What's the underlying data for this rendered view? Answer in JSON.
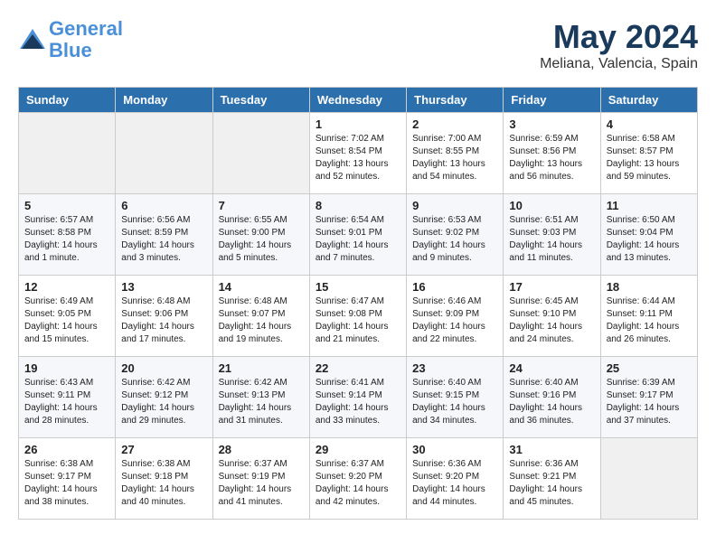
{
  "header": {
    "logo_line1": "General",
    "logo_line2": "Blue",
    "month": "May 2024",
    "location": "Meliana, Valencia, Spain"
  },
  "weekdays": [
    "Sunday",
    "Monday",
    "Tuesday",
    "Wednesday",
    "Thursday",
    "Friday",
    "Saturday"
  ],
  "weeks": [
    [
      {
        "day": "",
        "info": ""
      },
      {
        "day": "",
        "info": ""
      },
      {
        "day": "",
        "info": ""
      },
      {
        "day": "1",
        "info": "Sunrise: 7:02 AM\nSunset: 8:54 PM\nDaylight: 13 hours\nand 52 minutes."
      },
      {
        "day": "2",
        "info": "Sunrise: 7:00 AM\nSunset: 8:55 PM\nDaylight: 13 hours\nand 54 minutes."
      },
      {
        "day": "3",
        "info": "Sunrise: 6:59 AM\nSunset: 8:56 PM\nDaylight: 13 hours\nand 56 minutes."
      },
      {
        "day": "4",
        "info": "Sunrise: 6:58 AM\nSunset: 8:57 PM\nDaylight: 13 hours\nand 59 minutes."
      }
    ],
    [
      {
        "day": "5",
        "info": "Sunrise: 6:57 AM\nSunset: 8:58 PM\nDaylight: 14 hours\nand 1 minute."
      },
      {
        "day": "6",
        "info": "Sunrise: 6:56 AM\nSunset: 8:59 PM\nDaylight: 14 hours\nand 3 minutes."
      },
      {
        "day": "7",
        "info": "Sunrise: 6:55 AM\nSunset: 9:00 PM\nDaylight: 14 hours\nand 5 minutes."
      },
      {
        "day": "8",
        "info": "Sunrise: 6:54 AM\nSunset: 9:01 PM\nDaylight: 14 hours\nand 7 minutes."
      },
      {
        "day": "9",
        "info": "Sunrise: 6:53 AM\nSunset: 9:02 PM\nDaylight: 14 hours\nand 9 minutes."
      },
      {
        "day": "10",
        "info": "Sunrise: 6:51 AM\nSunset: 9:03 PM\nDaylight: 14 hours\nand 11 minutes."
      },
      {
        "day": "11",
        "info": "Sunrise: 6:50 AM\nSunset: 9:04 PM\nDaylight: 14 hours\nand 13 minutes."
      }
    ],
    [
      {
        "day": "12",
        "info": "Sunrise: 6:49 AM\nSunset: 9:05 PM\nDaylight: 14 hours\nand 15 minutes."
      },
      {
        "day": "13",
        "info": "Sunrise: 6:48 AM\nSunset: 9:06 PM\nDaylight: 14 hours\nand 17 minutes."
      },
      {
        "day": "14",
        "info": "Sunrise: 6:48 AM\nSunset: 9:07 PM\nDaylight: 14 hours\nand 19 minutes."
      },
      {
        "day": "15",
        "info": "Sunrise: 6:47 AM\nSunset: 9:08 PM\nDaylight: 14 hours\nand 21 minutes."
      },
      {
        "day": "16",
        "info": "Sunrise: 6:46 AM\nSunset: 9:09 PM\nDaylight: 14 hours\nand 22 minutes."
      },
      {
        "day": "17",
        "info": "Sunrise: 6:45 AM\nSunset: 9:10 PM\nDaylight: 14 hours\nand 24 minutes."
      },
      {
        "day": "18",
        "info": "Sunrise: 6:44 AM\nSunset: 9:11 PM\nDaylight: 14 hours\nand 26 minutes."
      }
    ],
    [
      {
        "day": "19",
        "info": "Sunrise: 6:43 AM\nSunset: 9:11 PM\nDaylight: 14 hours\nand 28 minutes."
      },
      {
        "day": "20",
        "info": "Sunrise: 6:42 AM\nSunset: 9:12 PM\nDaylight: 14 hours\nand 29 minutes."
      },
      {
        "day": "21",
        "info": "Sunrise: 6:42 AM\nSunset: 9:13 PM\nDaylight: 14 hours\nand 31 minutes."
      },
      {
        "day": "22",
        "info": "Sunrise: 6:41 AM\nSunset: 9:14 PM\nDaylight: 14 hours\nand 33 minutes."
      },
      {
        "day": "23",
        "info": "Sunrise: 6:40 AM\nSunset: 9:15 PM\nDaylight: 14 hours\nand 34 minutes."
      },
      {
        "day": "24",
        "info": "Sunrise: 6:40 AM\nSunset: 9:16 PM\nDaylight: 14 hours\nand 36 minutes."
      },
      {
        "day": "25",
        "info": "Sunrise: 6:39 AM\nSunset: 9:17 PM\nDaylight: 14 hours\nand 37 minutes."
      }
    ],
    [
      {
        "day": "26",
        "info": "Sunrise: 6:38 AM\nSunset: 9:17 PM\nDaylight: 14 hours\nand 38 minutes."
      },
      {
        "day": "27",
        "info": "Sunrise: 6:38 AM\nSunset: 9:18 PM\nDaylight: 14 hours\nand 40 minutes."
      },
      {
        "day": "28",
        "info": "Sunrise: 6:37 AM\nSunset: 9:19 PM\nDaylight: 14 hours\nand 41 minutes."
      },
      {
        "day": "29",
        "info": "Sunrise: 6:37 AM\nSunset: 9:20 PM\nDaylight: 14 hours\nand 42 minutes."
      },
      {
        "day": "30",
        "info": "Sunrise: 6:36 AM\nSunset: 9:20 PM\nDaylight: 14 hours\nand 44 minutes."
      },
      {
        "day": "31",
        "info": "Sunrise: 6:36 AM\nSunset: 9:21 PM\nDaylight: 14 hours\nand 45 minutes."
      },
      {
        "day": "",
        "info": ""
      }
    ]
  ]
}
